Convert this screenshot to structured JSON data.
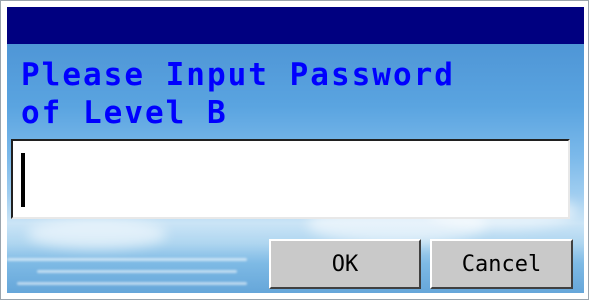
{
  "dialog": {
    "title": "",
    "prompt_line1": "Please Input Password",
    "prompt_line2": "of Level B",
    "password_value": "",
    "ok_label": "OK",
    "cancel_label": "Cancel"
  },
  "colors": {
    "titlebar": "#000080",
    "prompt_text": "#0000ff",
    "button_face": "#c9c9c9"
  }
}
